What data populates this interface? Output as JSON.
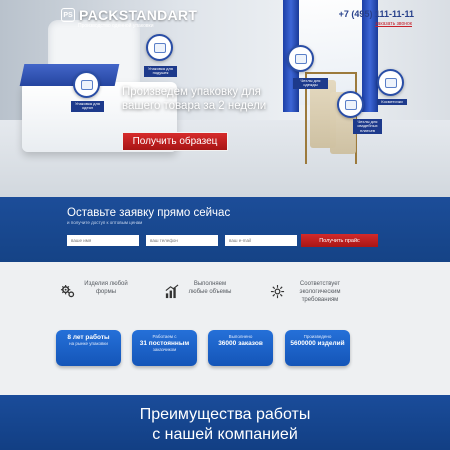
{
  "header": {
    "logo_mark": "PS",
    "logo_name": "PACKSTANDART",
    "logo_sub": "Производство оденной упаковки",
    "phone": "+7 (495) 111-11-11",
    "callback": "заказать звонок"
  },
  "hero": {
    "bubbles": [
      {
        "label": "Упаковка для подушек"
      },
      {
        "label": "Упаковка для одеял"
      },
      {
        "label": "Чехлы для одежды"
      },
      {
        "label": "Чехлы для свадебных платьев"
      },
      {
        "label": "Косметички"
      }
    ],
    "title": "Произведем упаковку для вашего товара за 2 недели",
    "sample_button": "Получить образец"
  },
  "form": {
    "title": "Оставьте заявку прямо сейчас",
    "subtitle": "и получите доступ к оптовым ценам",
    "name_placeholder": "ваше имя",
    "phone_placeholder": "ваш телефон",
    "email_placeholder": "ваш e-mail",
    "submit": "Получить прайс"
  },
  "features": [
    {
      "icon": "gears-icon",
      "text": "Изделия любой формы"
    },
    {
      "icon": "chart-icon",
      "text": "Выполняем любые объемы"
    },
    {
      "icon": "eco-icon",
      "text": "Соответствует экологическим требованиям"
    }
  ],
  "stats": [
    {
      "big": "8 лет работы",
      "small": "на рынке упаковки"
    },
    {
      "small_top": "Работаем с",
      "big": "31 постоянным",
      "small": "заказчиком"
    },
    {
      "small_top": "Выполнено",
      "big": "36000 заказов"
    },
    {
      "small_top": "Произведено",
      "big": "5600000 изделий"
    }
  ],
  "bottom": {
    "title_line1": "Преимущества работы",
    "title_line2": "с нашей компанией"
  },
  "colors": {
    "brand_blue": "#1c4d99",
    "accent_red": "#c8202a",
    "stat_blue": "#1e64c8"
  }
}
